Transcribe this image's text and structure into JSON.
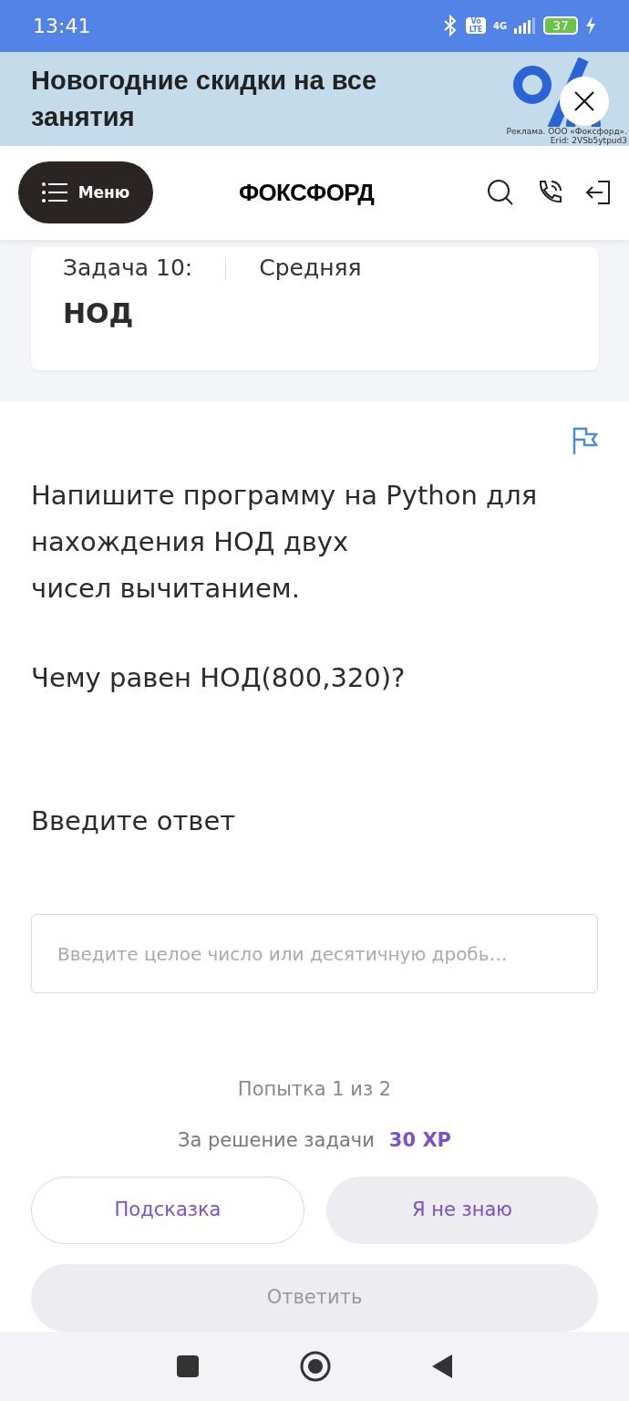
{
  "status_bar": {
    "time": "13:41",
    "volte": "Vo LTE",
    "network": "4G",
    "battery": "37"
  },
  "promo": {
    "title": "Новогодние скидки на все занятия",
    "disclaimer": "Реклама. ООО «Фоксфорд». Erid: 2VSb5ytpud3"
  },
  "header": {
    "menu_label": "Меню",
    "logo": "ФОКСФОРД"
  },
  "task_card": {
    "number": "Задача 10:",
    "difficulty": "Средняя",
    "title": "НОД"
  },
  "question": {
    "lines": [
      "Напишите программу на Python для нахождения НОД двух",
      "чисел вычитанием.",
      "Чему равен НОД(800,320)?"
    ]
  },
  "answer": {
    "label": "Введите ответ",
    "placeholder": "Введите целое число или десятичную дробь…"
  },
  "attempt": "Попытка 1 из 2",
  "reward": {
    "text": "За решение задачи",
    "xp": "30 XP"
  },
  "buttons": {
    "hint": "Подсказка",
    "dont_know": "Я не знаю",
    "submit": "Ответить",
    "submit_disabled": true
  }
}
